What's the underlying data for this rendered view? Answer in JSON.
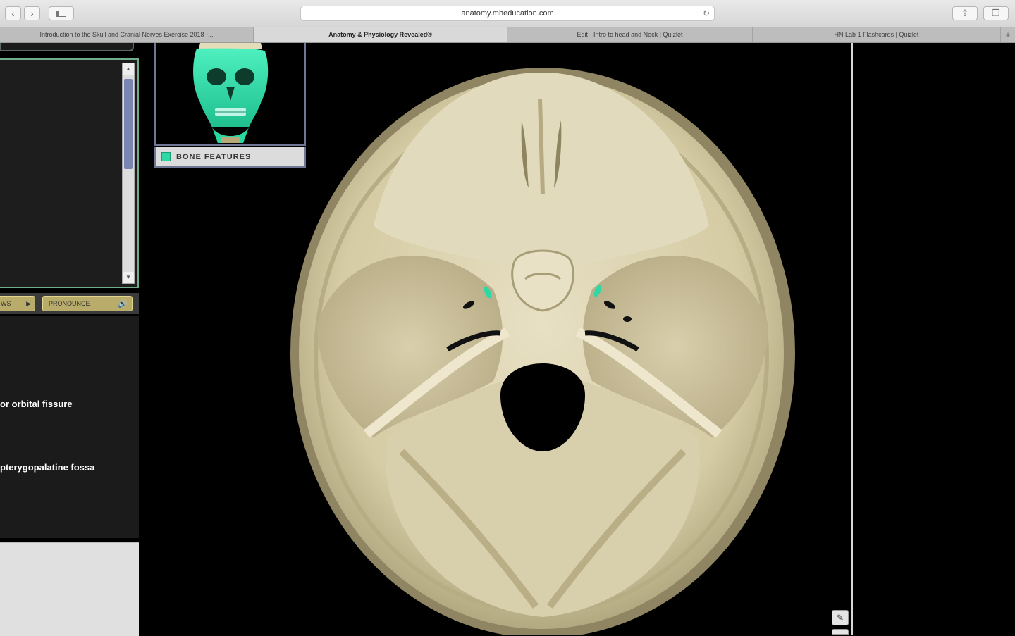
{
  "browser": {
    "url": "anatomy.mheducation.com",
    "tabs": [
      {
        "label": "Introduction to the Skull and Cranial Nerves Exercise 2018 -...",
        "active": false
      },
      {
        "label": "Anatomy & Physiology Revealed®",
        "active": true
      },
      {
        "label": "Edit - Intro to head and Neck | Quizlet",
        "active": false
      },
      {
        "label": "HN Lab 1 Flashcards | Quizlet",
        "active": false
      }
    ],
    "new_tab_glyph": "+",
    "back_icon": "chevron-left",
    "forward_icon": "chevron-right",
    "sidebar_icon": "sidebar",
    "share_icon": "share",
    "tabs_icon": "tabs"
  },
  "left_panel": {
    "buttons": {
      "views_label": "WS",
      "pronounce_label": "PRONOUNCE"
    },
    "descriptions": [
      "or orbital fissure",
      "pterygopalatine fossa"
    ]
  },
  "thumbnail": {
    "feature_label": "BONE FEATURES",
    "feature_color": "#2ed8a4"
  },
  "viewer": {
    "highlight_color": "#2ed8a4",
    "edit_icon": "pencil"
  }
}
